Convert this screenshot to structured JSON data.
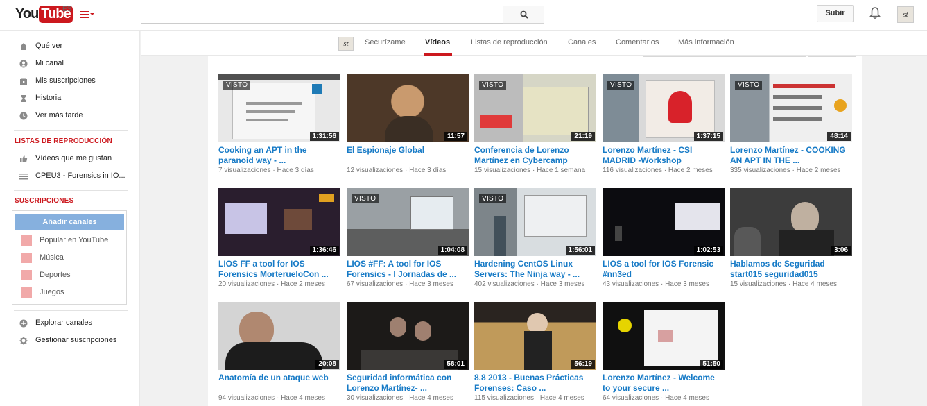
{
  "header": {
    "logo_you": "You",
    "logo_tube": "Tube",
    "locale": "ES",
    "search_placeholder": "",
    "upload_label": "Subir",
    "avatar_text": "st"
  },
  "sidebar": {
    "nav": [
      {
        "label": "Qué ver",
        "icon": "home-icon"
      },
      {
        "label": "Mi canal",
        "icon": "user-icon"
      },
      {
        "label": "Mis suscripciones",
        "icon": "subscriptions-icon"
      },
      {
        "label": "Historial",
        "icon": "history-icon"
      },
      {
        "label": "Ver más tarde",
        "icon": "clock-icon"
      }
    ],
    "playlists_title": "LISTAS DE REPRODUCCIÓN",
    "playlists": [
      {
        "label": "Vídeos que me gustan",
        "icon": "thumbs-up-icon"
      },
      {
        "label": "CPEU3 - Forensics in IO...",
        "icon": "playlist-icon"
      }
    ],
    "subscriptions_title": "SUSCRIPCIONES",
    "add_channels_label": "Añadir canales",
    "subscriptions": [
      {
        "label": "Popular en YouTube",
        "icon": "popular-icon"
      },
      {
        "label": "Música",
        "icon": "music-icon"
      },
      {
        "label": "Deportes",
        "icon": "sports-icon"
      },
      {
        "label": "Juegos",
        "icon": "gaming-icon"
      }
    ],
    "bottom": [
      {
        "label": "Explorar canales",
        "icon": "plus-circle-icon"
      },
      {
        "label": "Gestionar suscripciones",
        "icon": "gear-icon"
      }
    ]
  },
  "channel_nav": {
    "avatar_text": "st",
    "tabs": [
      "Securízame",
      "Vídeos",
      "Listas de reproducción",
      "Canales",
      "Comentarios",
      "Más información"
    ],
    "active_tab": "Vídeos"
  },
  "videos": [
    {
      "title": "Cooking an APT in the paranoid way - ...",
      "views": "7 visualizaciones",
      "age": "Hace 3 días",
      "duration": "1:31:56",
      "watched": "VISTO"
    },
    {
      "title": "El Espionaje Global",
      "views": "12 visualizaciones",
      "age": "Hace 3 días",
      "duration": "11:57",
      "watched": ""
    },
    {
      "title": "Conferencia de Lorenzo Martínez en Cybercamp",
      "views": "15 visualizaciones",
      "age": "Hace 1 semana",
      "duration": "21:19",
      "watched": "VISTO"
    },
    {
      "title": "Lorenzo Martínez - CSI MADRID -Workshop",
      "views": "116 visualizaciones",
      "age": "Hace 2 meses",
      "duration": "1:37:15",
      "watched": "VISTO"
    },
    {
      "title": "Lorenzo Martínez - COOKING AN APT IN THE ...",
      "views": "335 visualizaciones",
      "age": "Hace 2 meses",
      "duration": "48:14",
      "watched": "VISTO"
    },
    {
      "title": "LIOS FF a tool for IOS Forensics MorterueloCon ...",
      "views": "20 visualizaciones",
      "age": "Hace 2 meses",
      "duration": "1:36:46",
      "watched": ""
    },
    {
      "title": "LIOS #FF: A tool for IOS Forensics - I Jornadas de ...",
      "views": "67 visualizaciones",
      "age": "Hace 3 meses",
      "duration": "1:04:08",
      "watched": "VISTO"
    },
    {
      "title": "Hardening CentOS Linux Servers: The Ninja way - ...",
      "views": "402 visualizaciones",
      "age": "Hace 3 meses",
      "duration": "1:56:01",
      "watched": "VISTO"
    },
    {
      "title": "LIOS a tool for IOS Forensic #nn3ed",
      "views": "43 visualizaciones",
      "age": "Hace 3 meses",
      "duration": "1:02:53",
      "watched": ""
    },
    {
      "title": "Hablamos de Seguridad start015 seguridad015",
      "views": "15 visualizaciones",
      "age": "Hace 4 meses",
      "duration": "3:06",
      "watched": ""
    },
    {
      "title": "Anatomía de un ataque web",
      "views": "94 visualizaciones",
      "age": "Hace 4 meses",
      "duration": "20:08",
      "watched": ""
    },
    {
      "title": "Seguridad informática con Lorenzo Martínez- ...",
      "views": "30 visualizaciones",
      "age": "Hace 4 meses",
      "duration": "58:01",
      "watched": ""
    },
    {
      "title": "8.8 2013 - Buenas Prácticas Forenses: Caso ...",
      "views": "115 visualizaciones",
      "age": "Hace 4 meses",
      "duration": "56:19",
      "watched": ""
    },
    {
      "title": "Lorenzo Martínez - Welcome to your secure ...",
      "views": "64 visualizaciones",
      "age": "Hace 4 meses",
      "duration": "51:50",
      "watched": ""
    }
  ]
}
